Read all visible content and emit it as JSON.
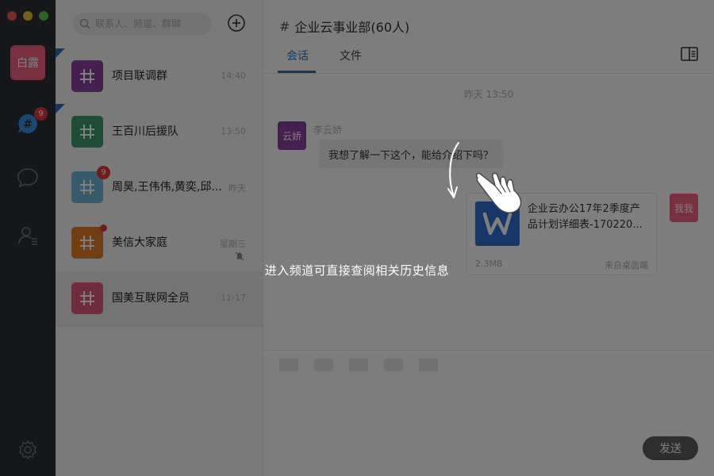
{
  "window": {
    "controls": [
      "close",
      "minimize",
      "zoom"
    ],
    "colors": {
      "close": "#ee5a4e",
      "minimize": "#f1bd3a",
      "zoom": "#5cc441"
    }
  },
  "rail": {
    "user_avatar_label": "白露",
    "user_avatar_color": "#f0607e",
    "channels_badge": "9",
    "icons": [
      "channels-icon",
      "chat-icon",
      "contacts-icon",
      "settings-icon"
    ]
  },
  "search": {
    "placeholder": "联系人、频道、群聊",
    "value": ""
  },
  "conversations": [
    {
      "name": "项目联调群",
      "time": "14:40",
      "avatar_color": "#8b3fa0",
      "pinned": true,
      "badge": "",
      "dot": false,
      "muted": false
    },
    {
      "name": "王百川后援队",
      "time": "13:50",
      "avatar_color": "#3a9a6a",
      "pinned": true,
      "badge": "",
      "dot": false,
      "muted": false
    },
    {
      "name": "周昊,王伟伟,黄奕,邱...",
      "time": "昨天",
      "avatar_color": "#6fb7d6",
      "pinned": false,
      "badge": "9",
      "dot": false,
      "muted": false
    },
    {
      "name": "美信大家庭",
      "time": "星期三",
      "avatar_color": "#e07a2a",
      "pinned": false,
      "badge": "",
      "dot": true,
      "muted": true
    },
    {
      "name": "国美互联网全员",
      "time": "11-17",
      "avatar_color": "#e05a7a",
      "pinned": false,
      "badge": "",
      "dot": false,
      "muted": false,
      "active": true
    }
  ],
  "chat": {
    "title": "企业云事业部(60人)",
    "tabs": [
      "会话",
      "文件"
    ],
    "active_tab": "会话",
    "timestamp": "昨天 13:50",
    "messages": [
      {
        "sender": "李云娇",
        "avatar_label": "云娇",
        "text": "我想了解一下这个，能给介绍下吗？"
      }
    ],
    "file_message": {
      "avatar_label": "我我",
      "file_name_line1": "企业云办公17年2季度产",
      "file_name_line2": "品计划详细表-170220...",
      "file_size": "2.3MB",
      "source": "来自桌面端"
    },
    "send_label": "发送"
  },
  "overlay": {
    "hint": "进入频道可直接查阅相关历史信息"
  }
}
